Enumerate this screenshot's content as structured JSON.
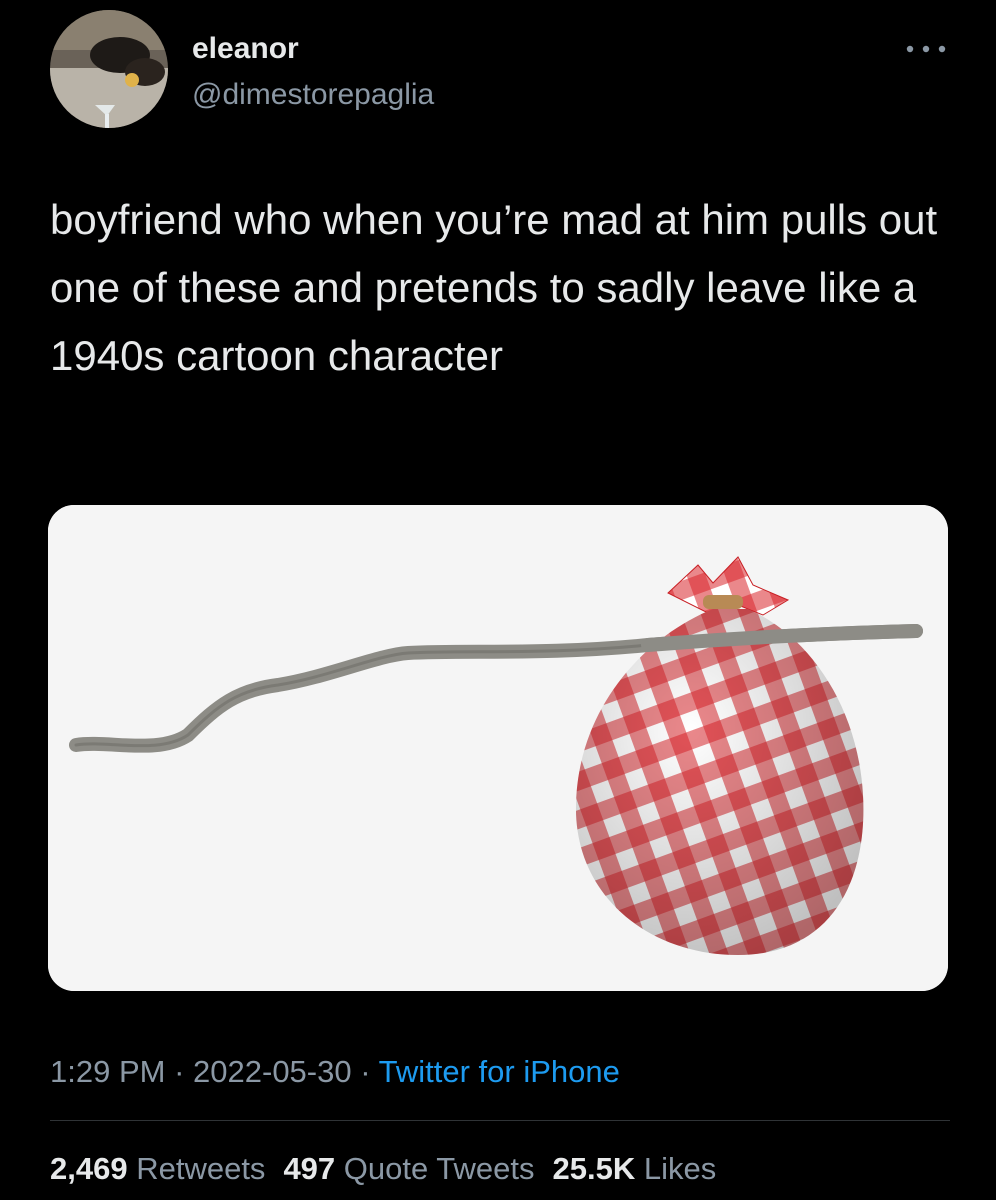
{
  "tweet": {
    "author": {
      "display_name": "eleanor",
      "handle": "@dimestorepaglia",
      "avatar_icon": "profile-photo"
    },
    "more_icon": "ellipsis-icon",
    "text": "boyfriend who when you’re mad at him pulls out one of these and pretends to sadly leave like a 1940s cartoon character",
    "media": {
      "kind": "image",
      "subject_icon": "bindle-stick-with-red-gingham-bundle"
    },
    "meta": {
      "time": "1:29 PM",
      "separator": "·",
      "date": "2022-05-30",
      "source": "Twitter for iPhone"
    },
    "stats": {
      "retweets_count": "2,469",
      "retweets_label": "Retweets",
      "quotes_count": "497",
      "quotes_label": "Quote Tweets",
      "likes_count": "25.5K",
      "likes_label": "Likes"
    }
  },
  "colors": {
    "background": "#000000",
    "primary_text": "#e7e9ea",
    "secondary_text": "#8b98a5",
    "link": "#1d9bf0",
    "divider": "#2f3336",
    "gingham_red": "#d8262b"
  }
}
